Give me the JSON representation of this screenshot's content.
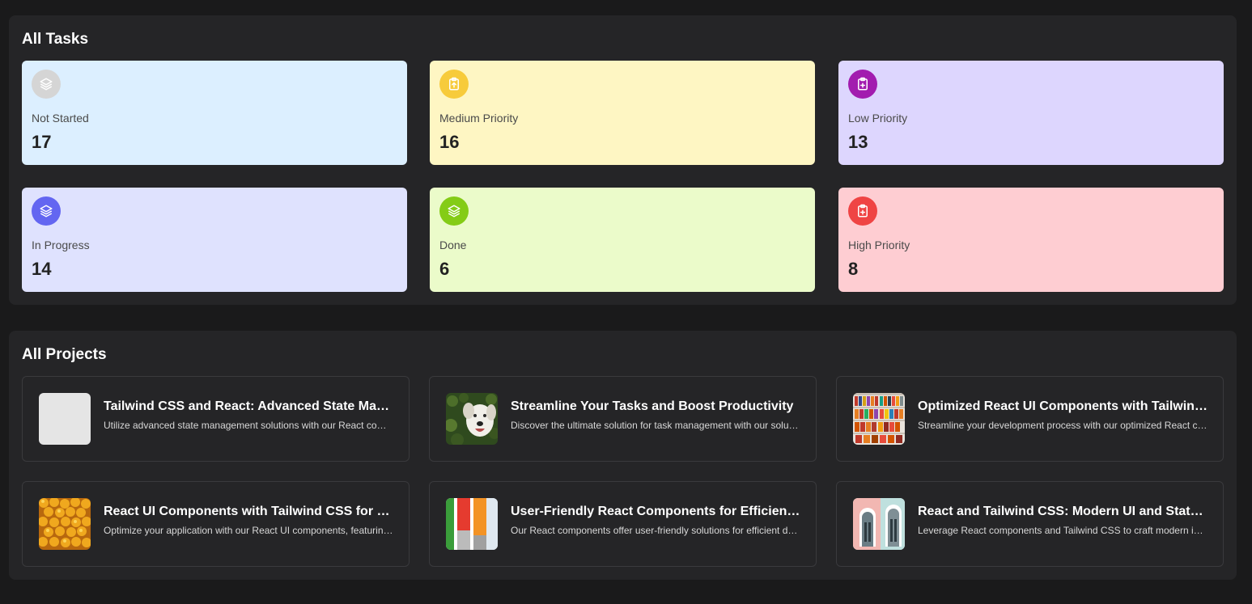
{
  "tasks_section": {
    "title": "All Tasks",
    "cards": [
      {
        "label": "Not Started",
        "count": "17",
        "icon": "layers-icon",
        "bg": "#dcefff",
        "icon_bg": "#d5d5d5"
      },
      {
        "label": "Medium Priority",
        "count": "16",
        "icon": "clipboard-up-icon",
        "bg": "#fef6c3",
        "icon_bg": "#f7cb3b"
      },
      {
        "label": "Low Priority",
        "count": "13",
        "icon": "clipboard-plus-icon",
        "bg": "#ddd6fe",
        "icon_bg": "#a21caf"
      },
      {
        "label": "In Progress",
        "count": "14",
        "icon": "layers-icon",
        "bg": "#dfe2fe",
        "icon_bg": "#6366f1"
      },
      {
        "label": "Done",
        "count": "6",
        "icon": "layers-icon",
        "bg": "#ebfbca",
        "icon_bg": "#84cc16"
      },
      {
        "label": "High Priority",
        "count": "8",
        "icon": "clipboard-plus-icon",
        "bg": "#fecdd2",
        "icon_bg": "#ef4444"
      }
    ]
  },
  "projects_section": {
    "title": "All Projects",
    "projects": [
      {
        "title": "Tailwind CSS and React: Advanced State Management",
        "description": "Utilize advanced state management solutions with our React components",
        "thumbnail": "blank-thumbnail"
      },
      {
        "title": "Streamline Your Tasks and Boost Productivity",
        "description": "Discover the ultimate solution for task management with our solution",
        "thumbnail": "dog-photo"
      },
      {
        "title": "Optimized React UI Components with Tailwind CSS",
        "description": "Streamline your development process with our optimized React components",
        "thumbnail": "shelves-photo"
      },
      {
        "title": "React UI Components with Tailwind CSS for Modern Apps",
        "description": "Optimize your application with our React UI components, featuring Tailwind CSS",
        "thumbnail": "fruit-photo"
      },
      {
        "title": "User-Friendly React Components for Efficient Development",
        "description": "Our React components offer user-friendly solutions for efficient development",
        "thumbnail": "paint-photo"
      },
      {
        "title": "React and Tailwind CSS: Modern UI and State Management",
        "description": "Leverage React components and Tailwind CSS to craft modern interfaces",
        "thumbnail": "building-photo"
      }
    ]
  }
}
